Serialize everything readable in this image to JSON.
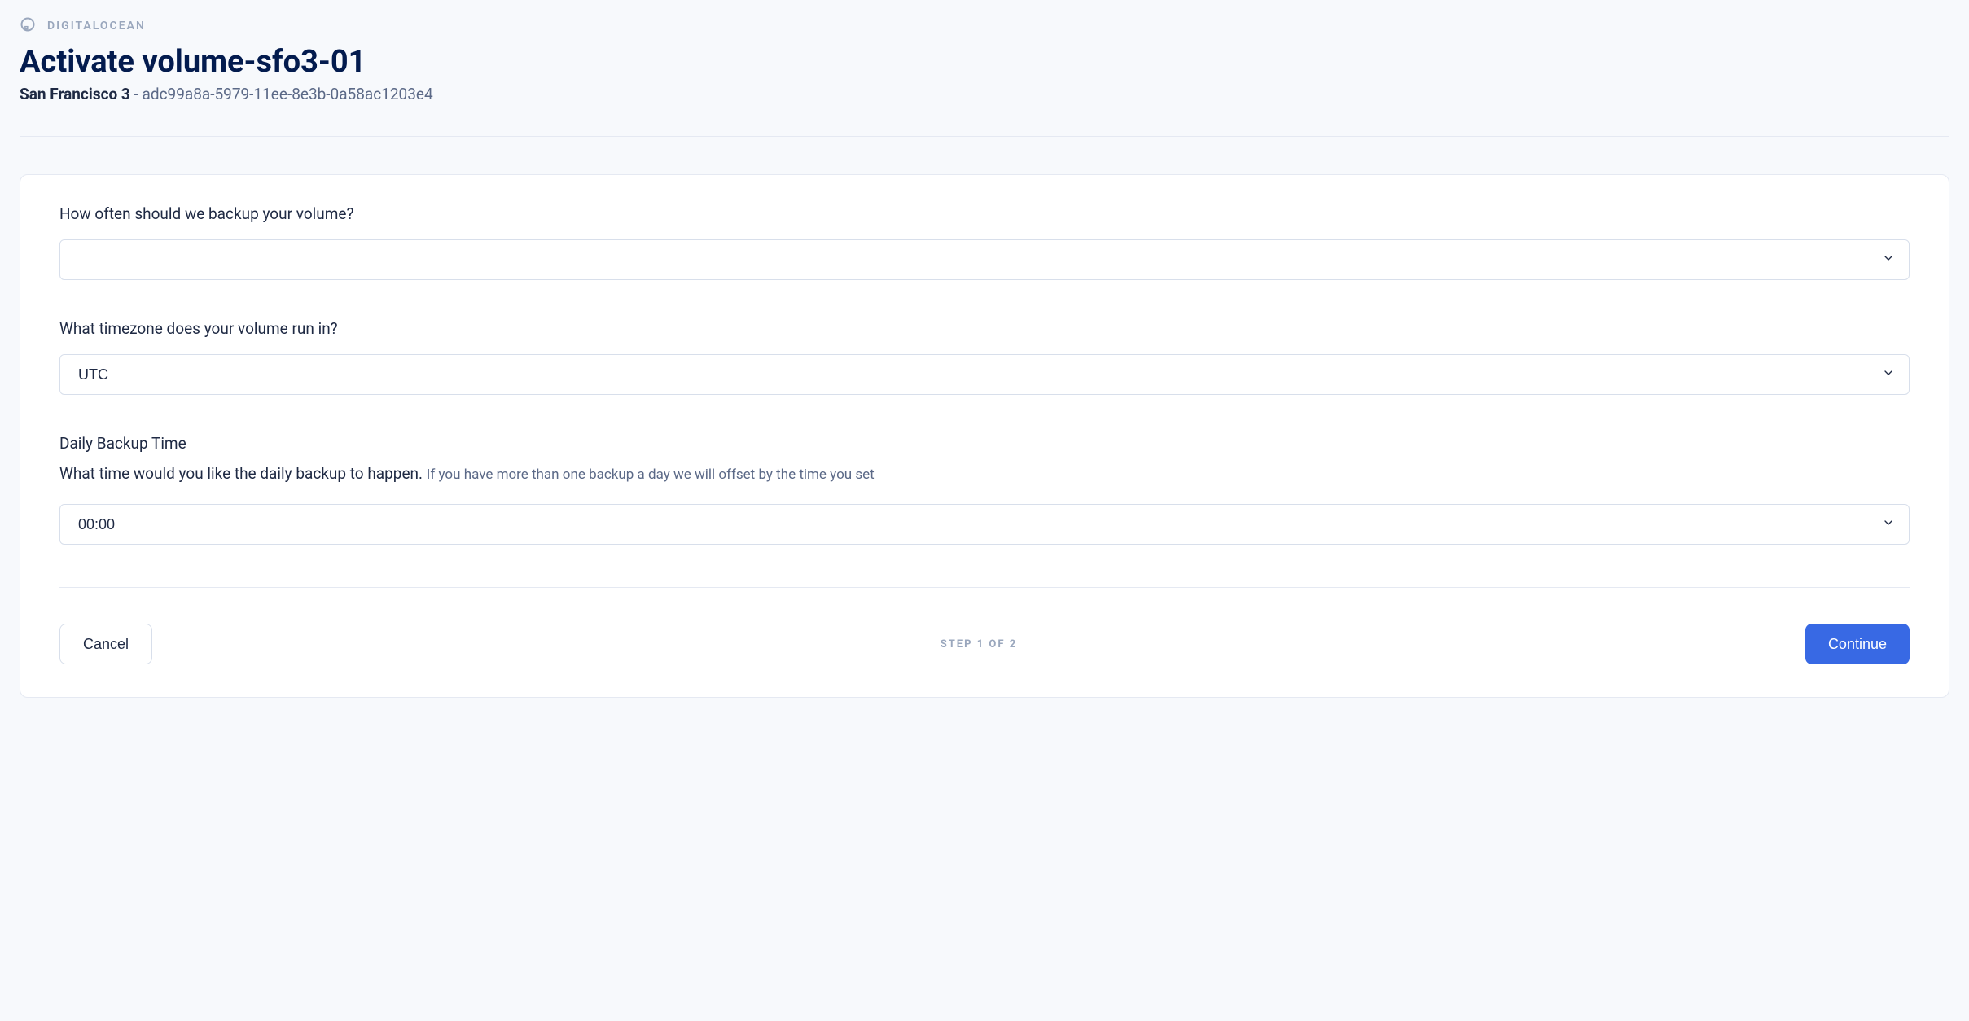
{
  "brand": {
    "name": "DIGITALOCEAN"
  },
  "header": {
    "title": "Activate volume-sfo3-01",
    "region": "San Francisco 3",
    "separator": " - ",
    "uuid": "adc99a8a-5979-11ee-8e3b-0a58ac1203e4"
  },
  "form": {
    "frequency": {
      "label": "How often should we backup your volume?",
      "value": ""
    },
    "timezone": {
      "label": "What timezone does your volume run in?",
      "value": "UTC"
    },
    "backup_time": {
      "heading": "Daily Backup Time",
      "desc_main": "What time would you like the daily backup to happen. ",
      "desc_hint": "If you have more than one backup a day we will offset by the time you set",
      "value": "00:00"
    }
  },
  "footer": {
    "cancel": "Cancel",
    "step": "STEP 1 OF 2",
    "continue": "Continue"
  }
}
